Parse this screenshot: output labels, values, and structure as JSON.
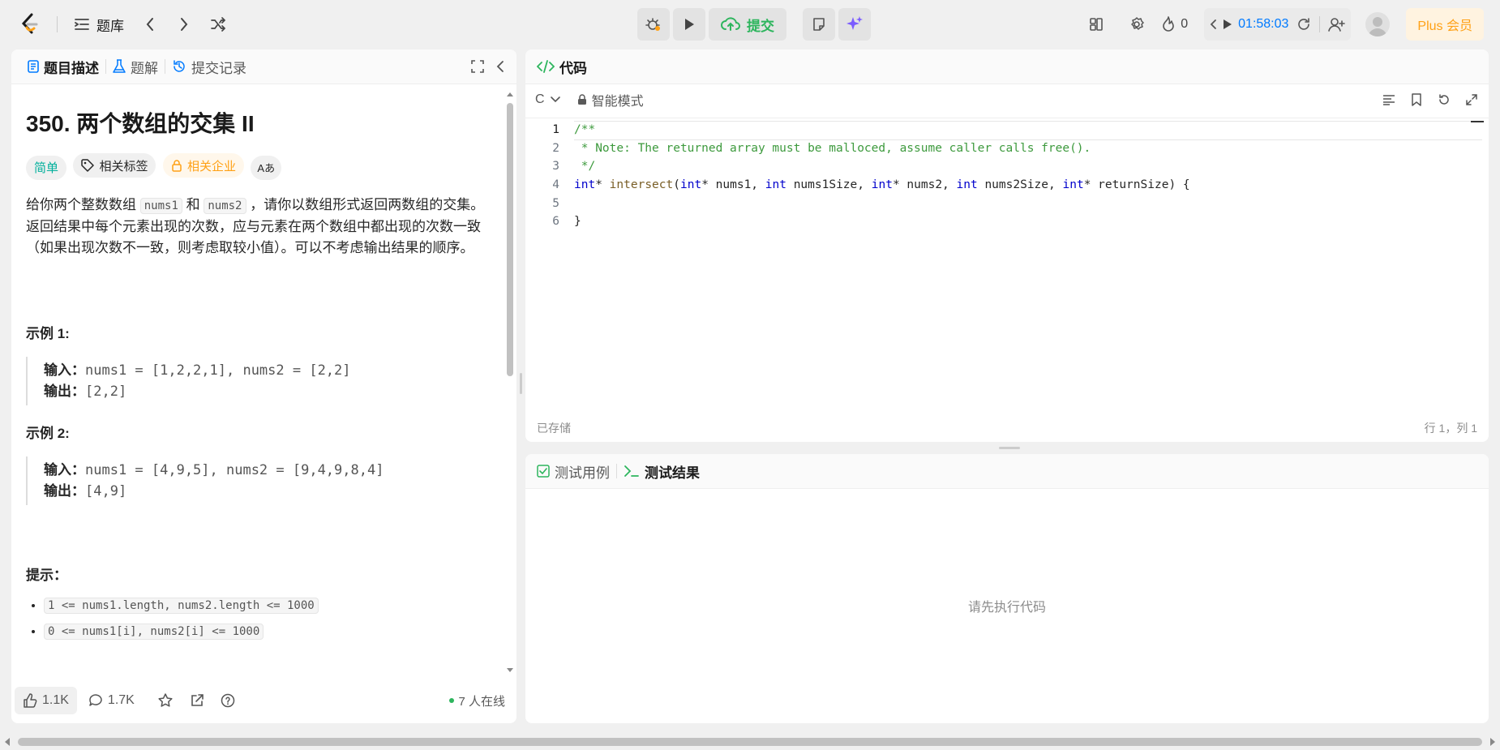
{
  "topbar": {
    "problem_list_label": "题库",
    "submit_label": "提交",
    "streak_count": "0",
    "timer": "01:58:03",
    "plus_label": "Plus 会员"
  },
  "left_panel": {
    "tabs": [
      "题目描述",
      "题解",
      "提交记录"
    ],
    "title": "350. 两个数组的交集 II",
    "tags": [
      "简单",
      "相关标签",
      "相关企业",
      "Aあ"
    ],
    "description": {
      "part1": "给你两个整数数组 ",
      "code1": "nums1",
      "part2": " 和 ",
      "code2": "nums2",
      "part3": " ，请你以数组形式返回两数组的交集。返回结果中每个元素出现的次数，应与元素在两个数组中都出现的次数一致（如果出现次数不一致，则考虑取较小值）。可以不考虑输出结果的顺序。"
    },
    "examples": [
      {
        "title": "示例 1:",
        "input_label": "输入：",
        "input": "nums1 = [1,2,2,1], nums2 = [2,2]",
        "output_label": "输出：",
        "output": "[2,2]"
      },
      {
        "title": "示例 2:",
        "input_label": "输入：",
        "input": "nums1 = [4,9,5], nums2 = [9,4,9,8,4]",
        "output_label": "输出：",
        "output": "[4,9]"
      }
    ],
    "hints_title": "提示：",
    "hints": [
      "1 <= nums1.length, nums2.length <= 1000",
      "0 <= nums1[i], nums2[i] <= 1000"
    ],
    "bottom": {
      "likes": "1.1K",
      "comments": "1.7K",
      "online": "7 人在线"
    }
  },
  "code_panel": {
    "tab_label": "代码",
    "language": "C",
    "mode": "智能模式",
    "line_numbers": [
      "1",
      "2",
      "3",
      "4",
      "5",
      "6"
    ],
    "code": {
      "l1": "/**",
      "l2": " * Note: The returned array must be malloced, assume caller calls free().",
      "l3": " */",
      "l4_int": "int",
      "l4_star": "* ",
      "l4_fn": "intersect",
      "l4_p1": "(",
      "l4_int2": "int",
      "l4_p2": "* nums1, ",
      "l4_int3": "int",
      "l4_p3": " nums1Size, ",
      "l4_int4": "int",
      "l4_p4": "* nums2, ",
      "l4_int5": "int",
      "l4_p5": " nums2Size, ",
      "l4_int6": "int",
      "l4_p6": "* returnSize) {",
      "l6": "}"
    },
    "status_saved": "已存储",
    "cursor_pos": "行 1，列 1"
  },
  "test_panel": {
    "tabs": [
      "测试用例",
      "测试结果"
    ],
    "empty_message": "请先执行代码"
  },
  "colors": {
    "accent_green": "#2db55d",
    "brand_orange": "#ffa116",
    "link_blue": "#007aff",
    "easy_teal": "#00af9b"
  }
}
